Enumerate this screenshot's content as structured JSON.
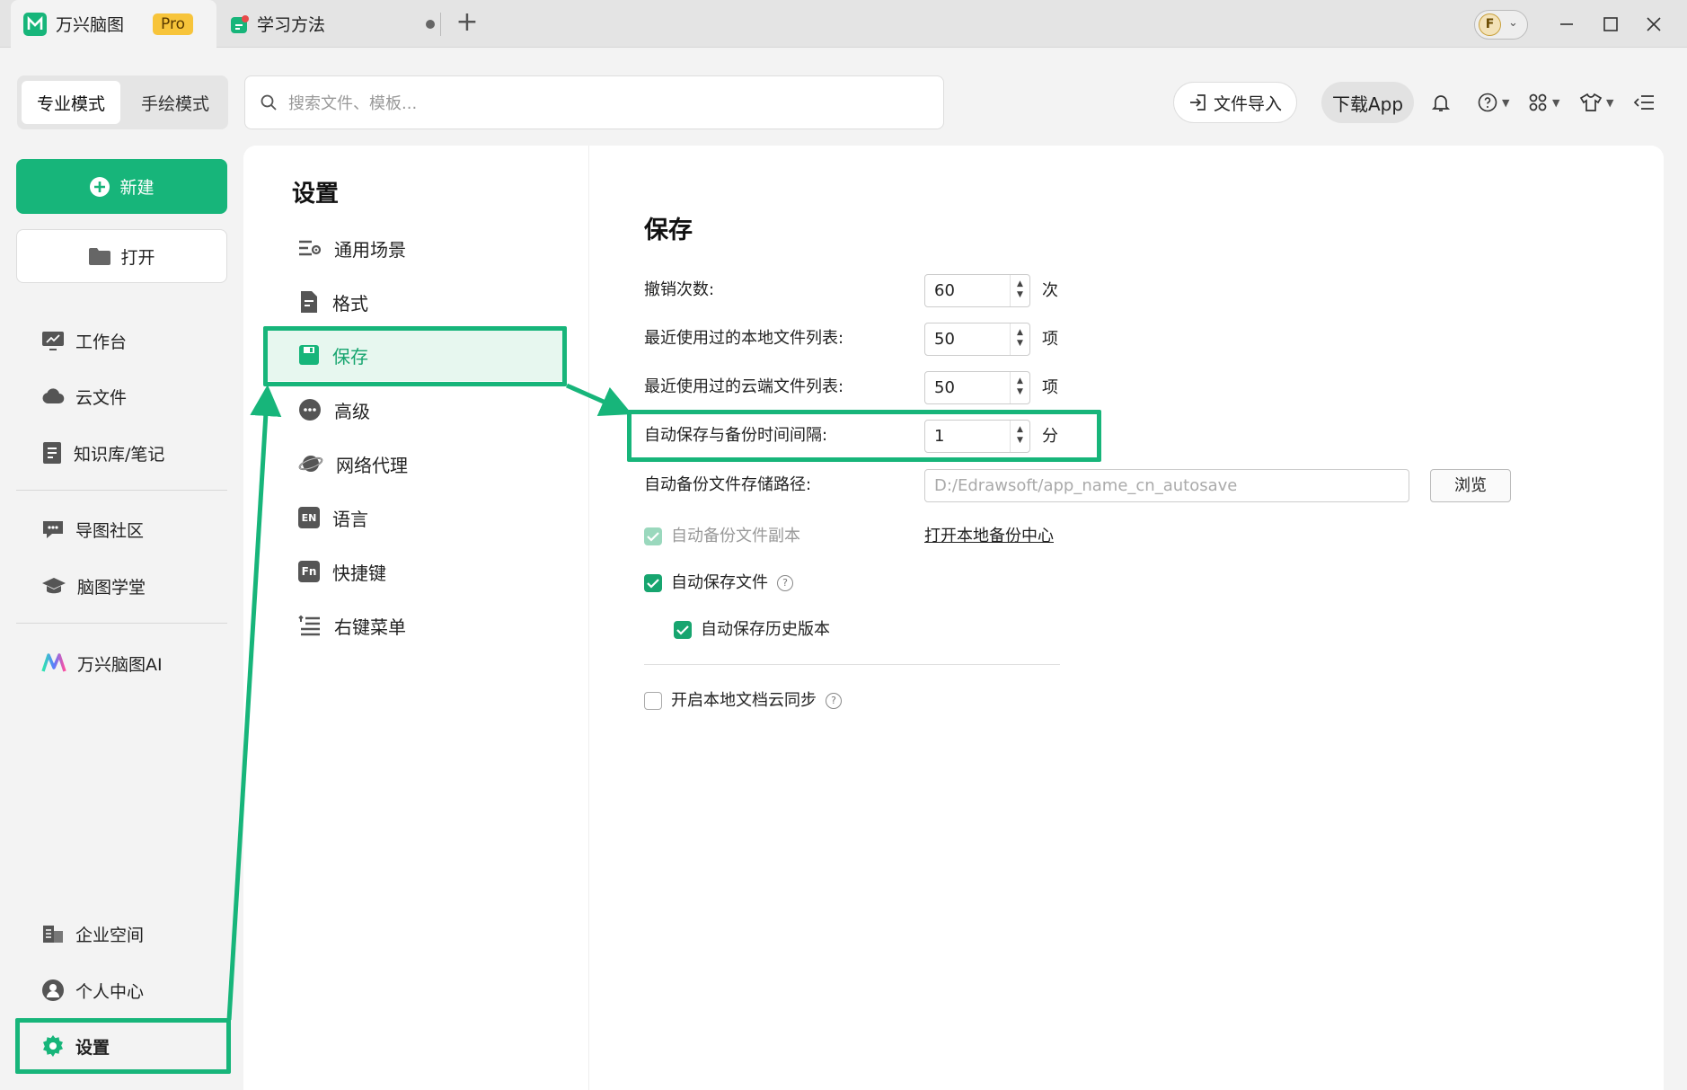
{
  "titlebar": {
    "app_tab_label": "万兴脑图",
    "pro_badge": "Pro",
    "doc_tab_label": "学习方法",
    "avatar_letter": "F"
  },
  "toolbar": {
    "mode_pro": "专业模式",
    "mode_hand": "手绘模式",
    "search_placeholder": "搜索文件、模板...",
    "import_label": "文件导入",
    "download_label": "下载App"
  },
  "sidebar": {
    "new_label": "新建",
    "open_label": "打开",
    "items_top": [
      {
        "label": "工作台",
        "icon": "workbench-icon"
      },
      {
        "label": "云文件",
        "icon": "cloud-icon"
      },
      {
        "label": "知识库/笔记",
        "icon": "notebook-icon"
      }
    ],
    "items_mid": [
      {
        "label": "导图社区",
        "icon": "community-icon"
      },
      {
        "label": "脑图学堂",
        "icon": "graduation-cap-icon"
      }
    ],
    "ai_label": "万兴脑图AI",
    "items_bottom": [
      {
        "label": "企业空间",
        "icon": "enterprise-icon"
      },
      {
        "label": "个人中心",
        "icon": "user-icon"
      },
      {
        "label": "设置",
        "icon": "gear-icon"
      }
    ]
  },
  "settings": {
    "title": "设置",
    "menu": [
      {
        "label": "通用场景",
        "icon": "general-settings-icon"
      },
      {
        "label": "格式",
        "icon": "format-icon"
      },
      {
        "label": "保存",
        "icon": "save-icon",
        "active": true
      },
      {
        "label": "高级",
        "icon": "more-icon"
      },
      {
        "label": "网络代理",
        "icon": "network-icon"
      },
      {
        "label": "语言",
        "icon": "language-icon",
        "glyph": "EN"
      },
      {
        "label": "快捷键",
        "icon": "shortcut-icon",
        "glyph": "Fn"
      },
      {
        "label": "右键菜单",
        "icon": "context-menu-icon"
      }
    ]
  },
  "save": {
    "title": "保存",
    "undo_label": "撤销次数:",
    "undo_value": "60",
    "undo_unit": "次",
    "recent_local_label": "最近使用过的本地文件列表:",
    "recent_local_value": "50",
    "recent_local_unit": "项",
    "recent_cloud_label": "最近使用过的云端文件列表:",
    "recent_cloud_value": "50",
    "recent_cloud_unit": "项",
    "autosave_interval_label": "自动保存与备份时间间隔:",
    "autosave_interval_value": "1",
    "autosave_interval_unit": "分",
    "backup_path_label": "自动备份文件存储路径:",
    "backup_path_placeholder": "D:/Edrawsoft/app_name_cn_autosave",
    "browse_label": "浏览",
    "backup_copy_label": "自动备份文件副本",
    "backup_copy_checked": true,
    "open_backup_center": "打开本地备份中心",
    "autosave_file_label": "自动保存文件",
    "autosave_file_checked": true,
    "autosave_history_label": "自动保存历史版本",
    "autosave_history_checked": true,
    "cloud_sync_label": "开启本地文档云同步",
    "cloud_sync_checked": false
  },
  "colors": {
    "accent": "#17b57a",
    "annotation": "#17b57a"
  }
}
